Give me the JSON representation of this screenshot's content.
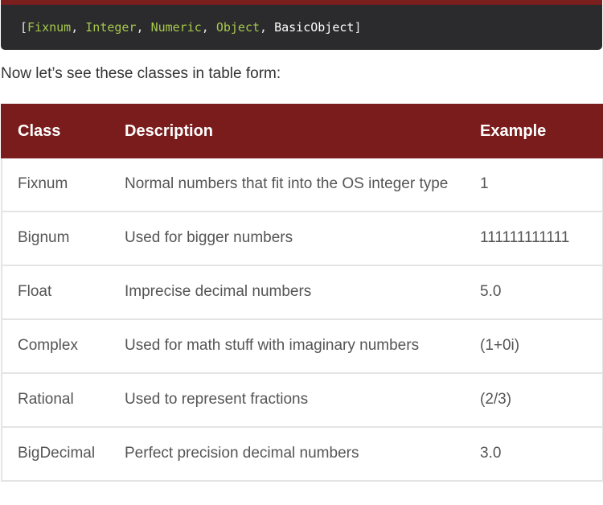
{
  "code": {
    "open_bracket": "[",
    "close_bracket": "]",
    "separator": ", ",
    "items": [
      "Fixnum",
      "Integer",
      "Numeric",
      "Object"
    ],
    "last_item": "BasicObject"
  },
  "intro_text": "Now let’s see these classes in table form:",
  "table": {
    "headers": [
      "Class",
      "Description",
      "Example"
    ],
    "rows": [
      {
        "class": "Fixnum",
        "description": "Normal numbers that fit into the OS integer type",
        "example": "1"
      },
      {
        "class": "Bignum",
        "description": "Used for bigger numbers",
        "example": "111111111111"
      },
      {
        "class": "Float",
        "description": "Imprecise decimal numbers",
        "example": "5.0"
      },
      {
        "class": "Complex",
        "description": "Used for math stuff with imaginary numbers",
        "example": "(1+0i)"
      },
      {
        "class": "Rational",
        "description": "Used to represent fractions",
        "example": "(2/3)"
      },
      {
        "class": "BigDecimal",
        "description": "Perfect precision decimal numbers",
        "example": "3.0"
      }
    ]
  },
  "colors": {
    "header_bg": "#7a1c1c",
    "code_bg": "#2b2b2e",
    "code_class": "#a6c94a"
  }
}
